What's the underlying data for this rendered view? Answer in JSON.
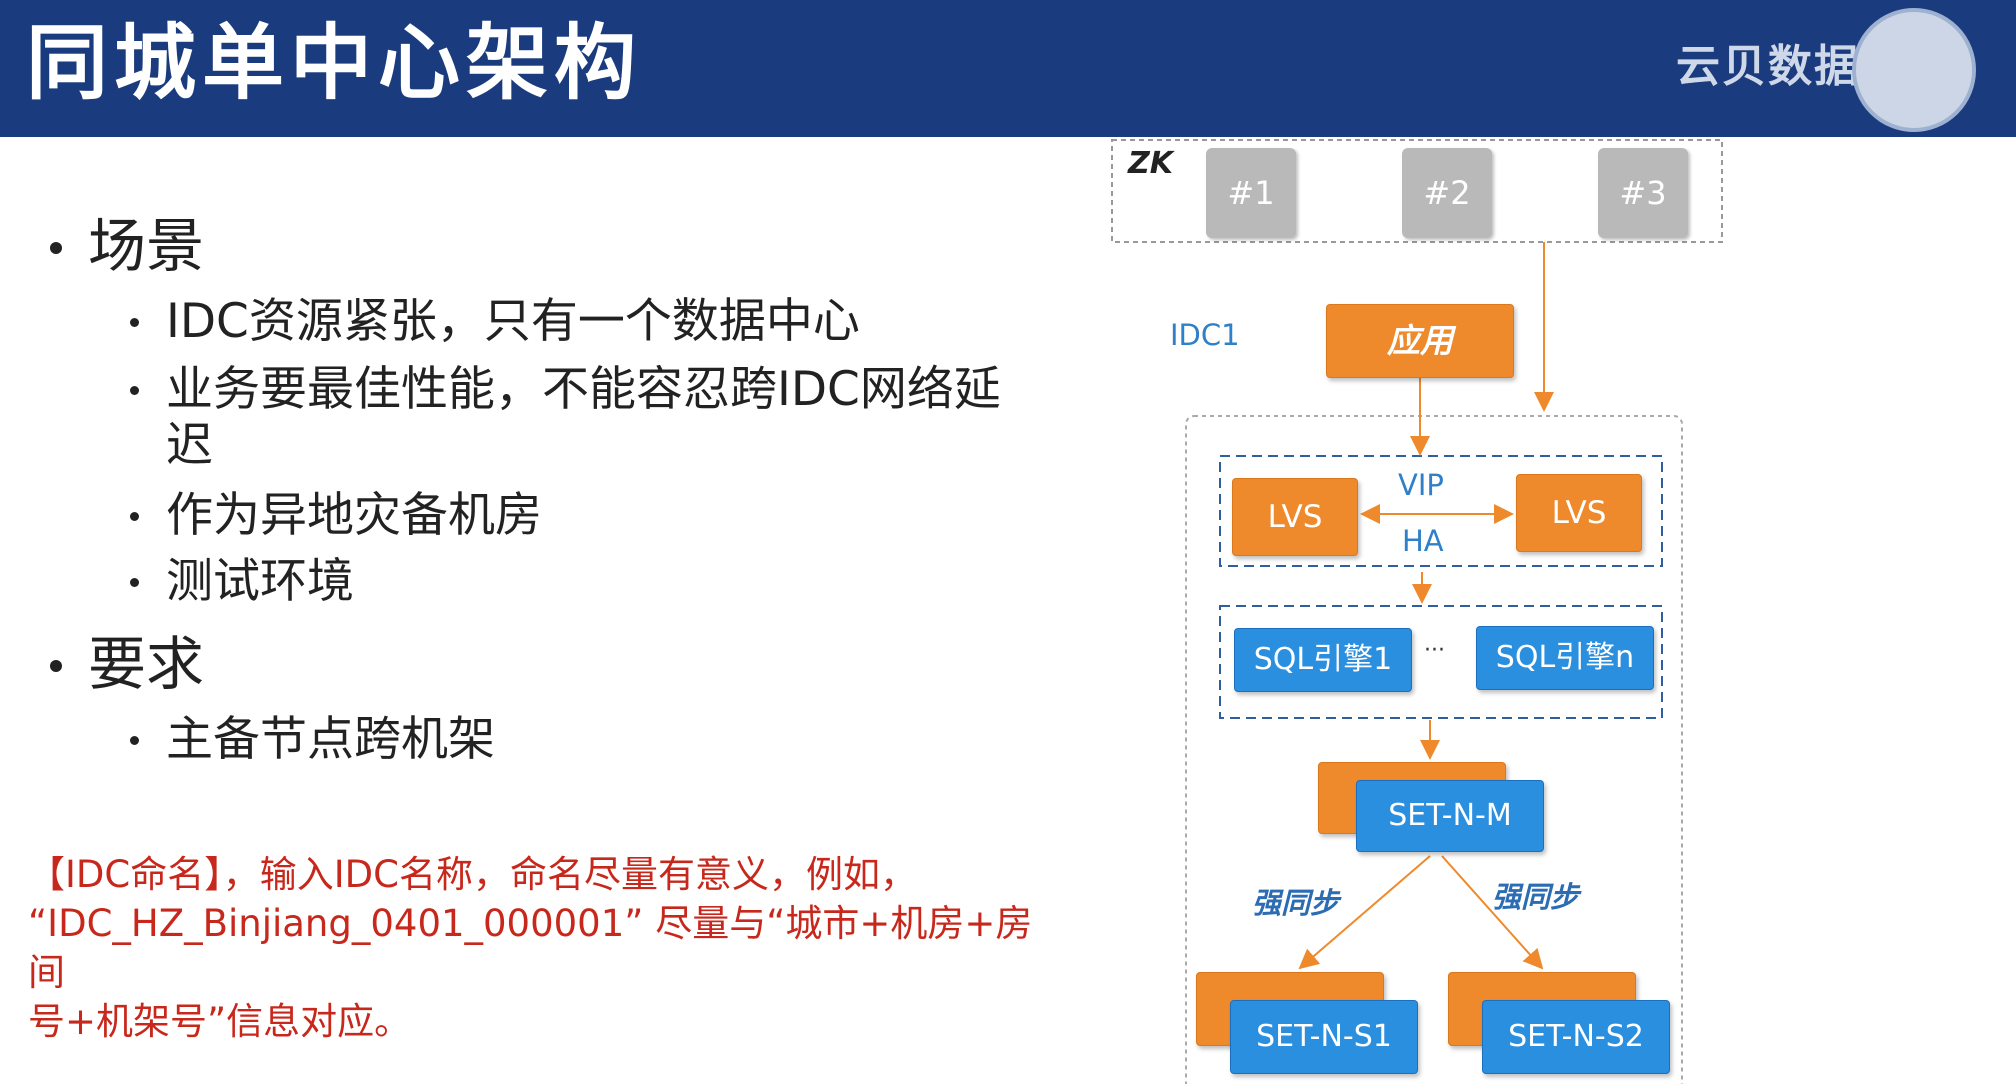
{
  "slide": {
    "title": "同城单中心架构",
    "logo_text": "云贝数据学堂"
  },
  "bullets": [
    {
      "label": "场景",
      "items": [
        "IDC资源紧张，只有一个数据中心",
        "业务要最佳性能，不能容忍跨IDC网络延",
        "迟",
        "作为异地灾备机房",
        "测试环境"
      ]
    },
    {
      "label": "要求",
      "items": [
        "主备节点跨机架"
      ]
    }
  ],
  "note": {
    "line1": "【IDC命名】，输入IDC名称，命名尽量有意义，例如，",
    "line2": "“IDC_HZ_Binjiang_0401_000001” 尽量与“城市+机房+房间",
    "line3": "号+机架号”信息对应。"
  },
  "diagram": {
    "zk_label": "ZK",
    "zk_nodes": [
      "#1",
      "#2",
      "#3"
    ],
    "idc_label": "IDC1",
    "app_label": "应用",
    "lvs_left": "LVS",
    "lvs_right": "LVS",
    "vip_label": "VIP",
    "ha_label": "HA",
    "sql_left": "SQL引擎1",
    "sql_ellipsis": "···",
    "sql_right": "SQL引擎n",
    "set_master": "SET-N-M",
    "sync_left": "强同步",
    "sync_right": "强同步",
    "set_slave1": "SET-N-S1",
    "set_slave2": "SET-N-S2",
    "colors": {
      "header": "#1a3c7e",
      "orange": "#ee8a2c",
      "blue": "#2b8fe0",
      "note": "#c8281c",
      "label": "#2f80c8"
    }
  }
}
